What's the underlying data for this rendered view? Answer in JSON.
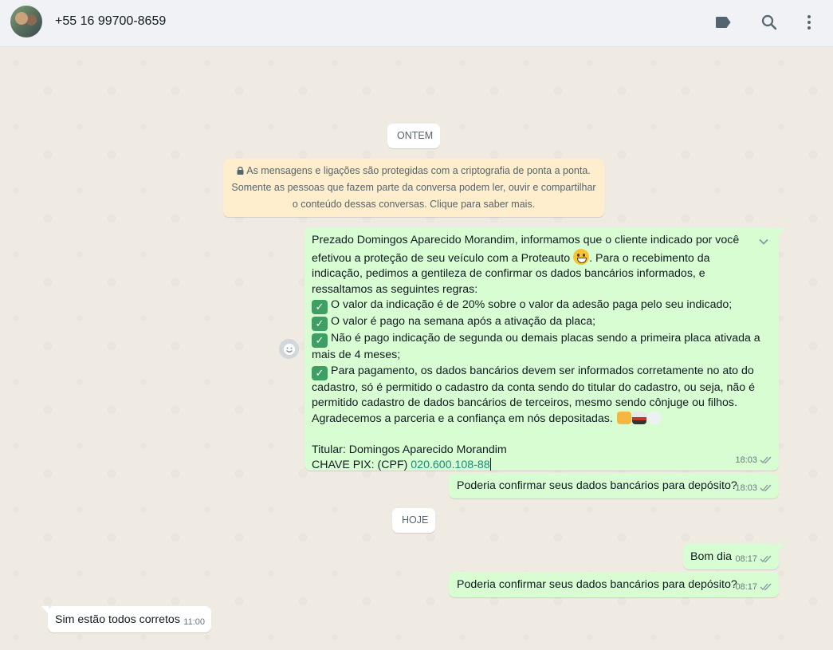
{
  "header": {
    "contact_name": "+55 16 99700-8659",
    "icons": [
      "label-icon",
      "search-icon",
      "kebab-menu-icon"
    ]
  },
  "chat": {
    "date_yesterday": "ONTEM",
    "encryption_notice": {
      "line1": "As mensagens e ligações são protegidas com a criptografia de ponta a ponta.",
      "line2": "Somente as pessoas que fazem parte da conversa podem ler, ouvir e compartilhar",
      "line3": "o conteúdo dessas conversas. Clique para saber mais."
    },
    "message1": {
      "intro_a": "Prezado Domingos Aparecido Morandim, informamos que o cliente indicado por você efetivou a proteção de seu veículo com a Proteauto ",
      "intro_b": ". Para o recebimento da indicação, pedimos a gentileza de confirmar os dados bancários informados, e  ressaltamos as seguintes regras:",
      "rule1": "O valor da indicação é de 20% sobre o valor da adesão paga pelo seu indicado;",
      "rule2": "O valor é pago na semana após a ativação da placa;",
      "rule3": "Não é pago indicação de segunda ou demais placas sendo a primeira placa ativada a mais de 4 meses;",
      "rule4": "Para pagamento, os dados bancários devem ser informados corretamente no ato do cadastro, só é permitido o cadastro da conta sendo do titular do cadastro, ou seja, não é permitido cadastro de dados bancários de terceiros, mesmo sendo cônjuge ou filhos.",
      "thanks": "Agradecemos a parceria e a confiança em nós depositadas. ",
      "holder": "Titular: Domingos Aparecido Morandim",
      "pix_label": "CHAVE PIX: (CPF) ",
      "pix_value": "020.600.108-88",
      "time": "18:03"
    },
    "message2": {
      "text": "Poderia confirmar seus dados bancários para depósito?",
      "time": "18:03"
    },
    "date_today": "HOJE",
    "message3": {
      "text": "Bom dia",
      "time": "08:17"
    },
    "message4": {
      "text": "Poderia confirmar seus dados bancários para depósito?",
      "time": "08:17"
    },
    "message5": {
      "text": "Sim estão todos corretos",
      "time": "11:00"
    }
  },
  "colors": {
    "outgoing_bubble": "#d9fdd3",
    "incoming_bubble": "#ffffff",
    "chat_background": "#efeae2",
    "encryption_notice_bg": "#ffeecd",
    "pix_link": "#128c7e"
  }
}
